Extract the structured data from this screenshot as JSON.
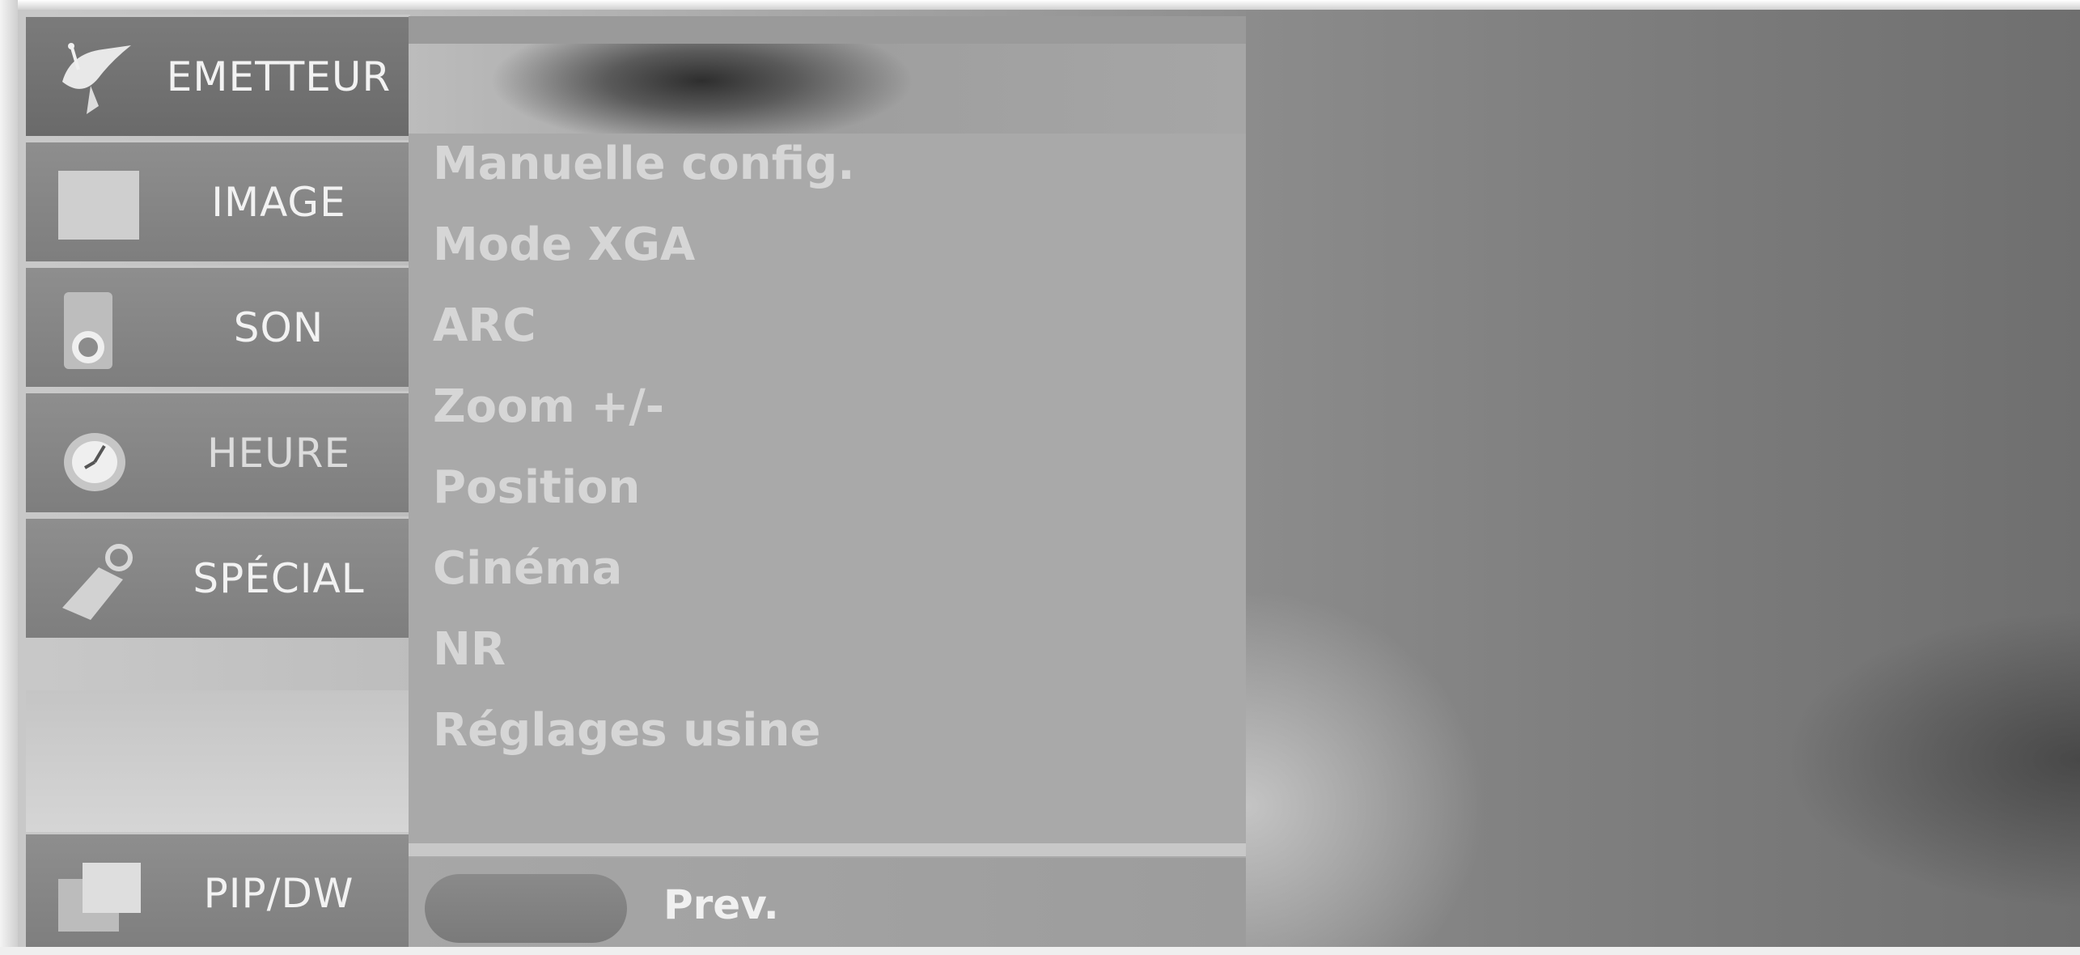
{
  "sidebar": {
    "items": [
      {
        "label": "EMETTEUR",
        "icon": "satellite-dish-icon"
      },
      {
        "label": "IMAGE",
        "icon": "picture-square-icon"
      },
      {
        "label": "SON",
        "icon": "speaker-icon"
      },
      {
        "label": "HEURE",
        "icon": "clock-icon"
      },
      {
        "label": "SPÉCIAL",
        "icon": "tag-icon"
      }
    ],
    "bottom_item": {
      "label": "PIP/DW",
      "icon": "pip-windows-icon"
    }
  },
  "menu": {
    "items": [
      "Manuelle config.",
      "Mode XGA",
      "ARC",
      "Zoom +/-",
      "Position",
      "Cinéma",
      "NR",
      "Réglages usine"
    ]
  },
  "footer": {
    "prev_label": "Prev."
  },
  "colors": {
    "panel": "#a9a9a9",
    "sidebar_item": "#8e8e8e",
    "menu_text": "#d6d6d6"
  }
}
